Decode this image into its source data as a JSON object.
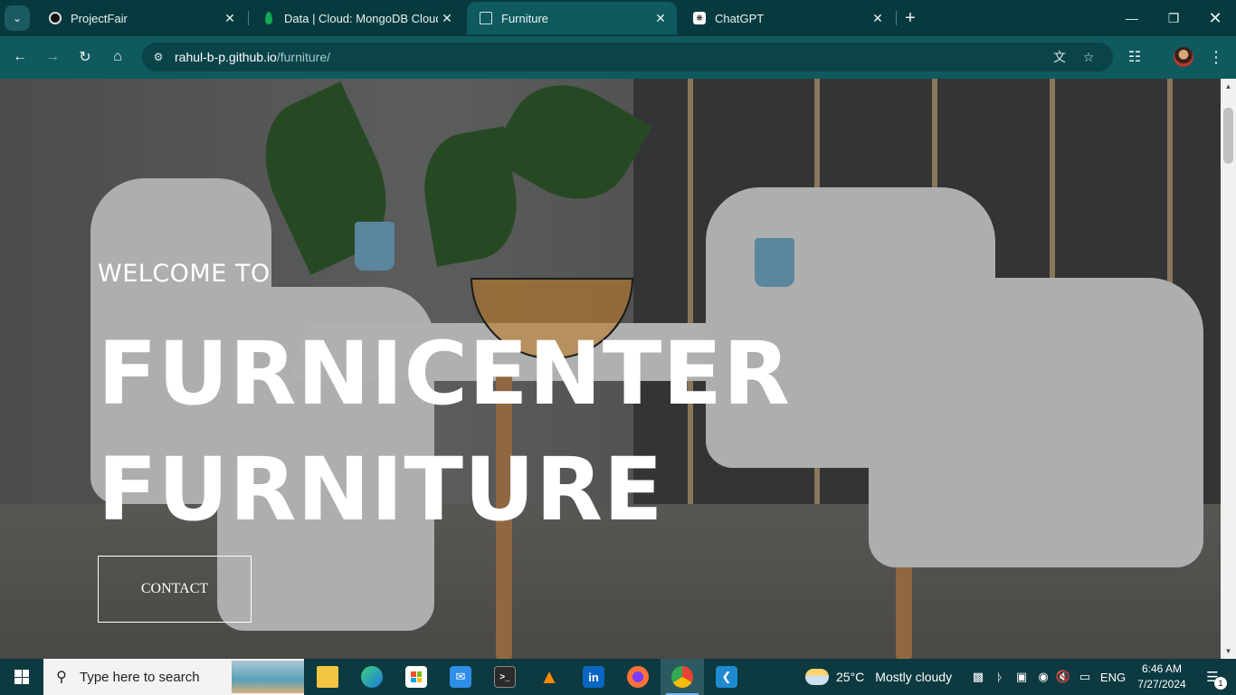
{
  "tabs": [
    {
      "title": "ProjectFair",
      "icon": "github-icon"
    },
    {
      "title": "Data | Cloud: MongoDB Cloud",
      "icon": "mongodb-leaf-icon"
    },
    {
      "title": "Furniture",
      "icon": "page-icon",
      "active": true
    },
    {
      "title": "ChatGPT",
      "icon": "openai-icon"
    }
  ],
  "toolbar": {
    "url_host": "rahul-b-p.github.io",
    "url_path": "/furniture/"
  },
  "hero": {
    "welcome": "WELCOME TO",
    "title_line1": "FURNICENTER",
    "title_line2": "FURNITURE",
    "contact_label": "CONTACT"
  },
  "taskbar": {
    "search_placeholder": "Type here to search",
    "weather_temp": "25°C",
    "weather_desc": "Mostly cloudy",
    "language": "ENG",
    "time": "6:46 AM",
    "date": "7/27/2024",
    "notification_count": "1"
  },
  "colors": {
    "tab_strip": "#073a3e",
    "toolbar": "#0f5a5f",
    "taskbar": "#0c3a40"
  }
}
